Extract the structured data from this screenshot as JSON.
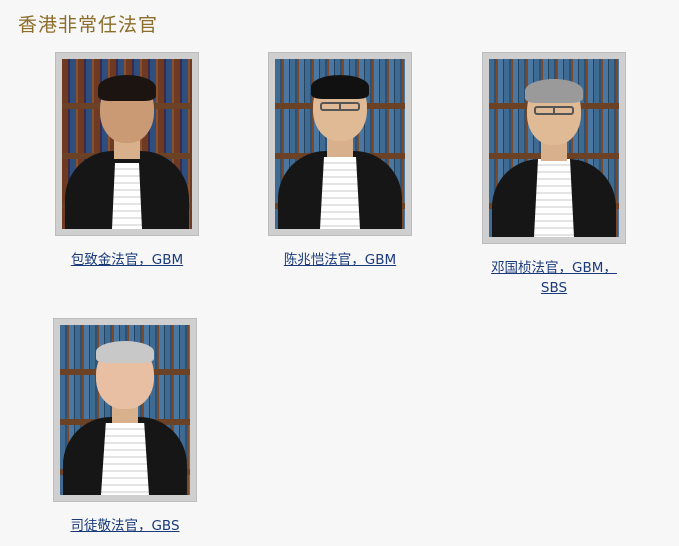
{
  "page": {
    "title": "香港非常任法官"
  },
  "judges": [
    {
      "name_line1": "包致金法官，GBM",
      "name_line2": "",
      "portrait_icon": "judge-portrait-icon"
    },
    {
      "name_line1": "陈兆恺法官，GBM",
      "name_line2": "",
      "portrait_icon": "judge-portrait-icon"
    },
    {
      "name_line1": "邓国桢法官，GBM，",
      "name_line2": "SBS",
      "portrait_icon": "judge-portrait-icon"
    },
    {
      "name_line1": "司徒敬法官，GBS",
      "name_line2": "",
      "portrait_icon": "judge-portrait-icon"
    }
  ],
  "colors": {
    "title": "#8c6d2a",
    "link": "#1a3a7a",
    "background": "#f7f7f7",
    "frame": "#cfcfcf"
  }
}
